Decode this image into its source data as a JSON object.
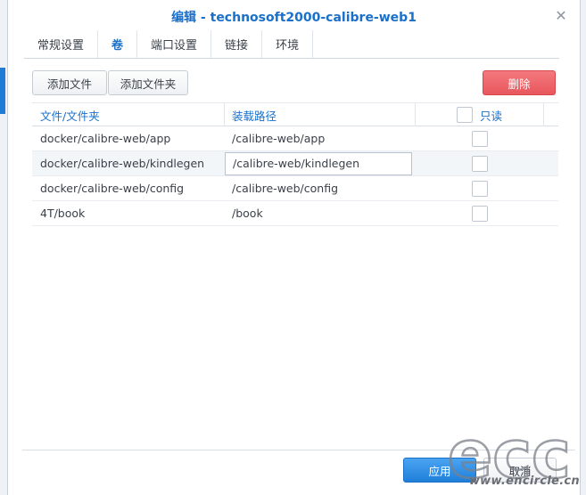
{
  "dialog": {
    "title": "编辑 - technosoft2000-calibre-web1"
  },
  "tabs": [
    {
      "label": "常规设置",
      "active": false
    },
    {
      "label": "卷",
      "active": true
    },
    {
      "label": "端口设置",
      "active": false
    },
    {
      "label": "链接",
      "active": false
    },
    {
      "label": "环境",
      "active": false
    }
  ],
  "toolbar": {
    "add_file": "添加文件",
    "add_folder": "添加文件夹",
    "delete": "删除"
  },
  "table": {
    "headers": {
      "file_folder": "文件/文件夹",
      "mount_path": "装载路径",
      "readonly": "只读"
    },
    "rows": [
      {
        "file": "docker/calibre-web/app",
        "mount": "/calibre-web/app",
        "readonly": false
      },
      {
        "file": "docker/calibre-web/kindlegen",
        "mount": "/calibre-web/kindlegen",
        "readonly": false
      },
      {
        "file": "docker/calibre-web/config",
        "mount": "/calibre-web/config",
        "readonly": false
      },
      {
        "file": "4T/book",
        "mount": "/book",
        "readonly": false
      }
    ]
  },
  "footer": {
    "apply": "应用",
    "cancel": "取消"
  },
  "watermark": {
    "logo": "ecc",
    "url": "www.encircle.cn"
  },
  "colors": {
    "accent": "#1a70c9",
    "danger": "#e8575d",
    "primary_button": "#1f7fd9"
  }
}
